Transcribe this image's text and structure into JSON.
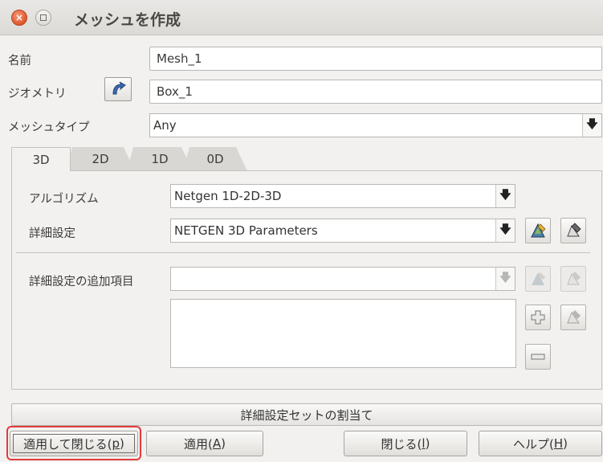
{
  "window": {
    "title": "メッシュを作成",
    "close_glyph": "×"
  },
  "form": {
    "name_label": "名前",
    "name_value": "Mesh_1",
    "geometry_label": "ジオメトリ",
    "geometry_value": "Box_1",
    "mesh_type_label": "メッシュタイプ",
    "mesh_type_value": "Any"
  },
  "tabs": [
    {
      "label": "3D",
      "active": true
    },
    {
      "label": "2D",
      "active": false
    },
    {
      "label": "1D",
      "active": false
    },
    {
      "label": "0D",
      "active": false
    }
  ],
  "panel": {
    "algorithm_label": "アルゴリズム",
    "algorithm_value": "Netgen 1D-2D-3D",
    "hypothesis_label": "詳細設定",
    "hypothesis_value": "NETGEN 3D Parameters",
    "additional_label": "詳細設定の追加項目",
    "additional_value": ""
  },
  "assign_button": "詳細設定セットの割当て",
  "buttons": {
    "apply_close": {
      "text": "適用して閉じる(",
      "mnemonic": "p",
      "suffix": ")"
    },
    "apply": {
      "text": "適用(",
      "mnemonic": "A",
      "suffix": ")"
    },
    "close": {
      "text": "閉じる(",
      "mnemonic": "l",
      "suffix": ")"
    },
    "help": {
      "text": "ヘルプ(",
      "mnemonic": "H",
      "suffix": ")"
    }
  },
  "colors": {
    "highlight": "#e23b3b",
    "close_button": "#e0552b"
  }
}
